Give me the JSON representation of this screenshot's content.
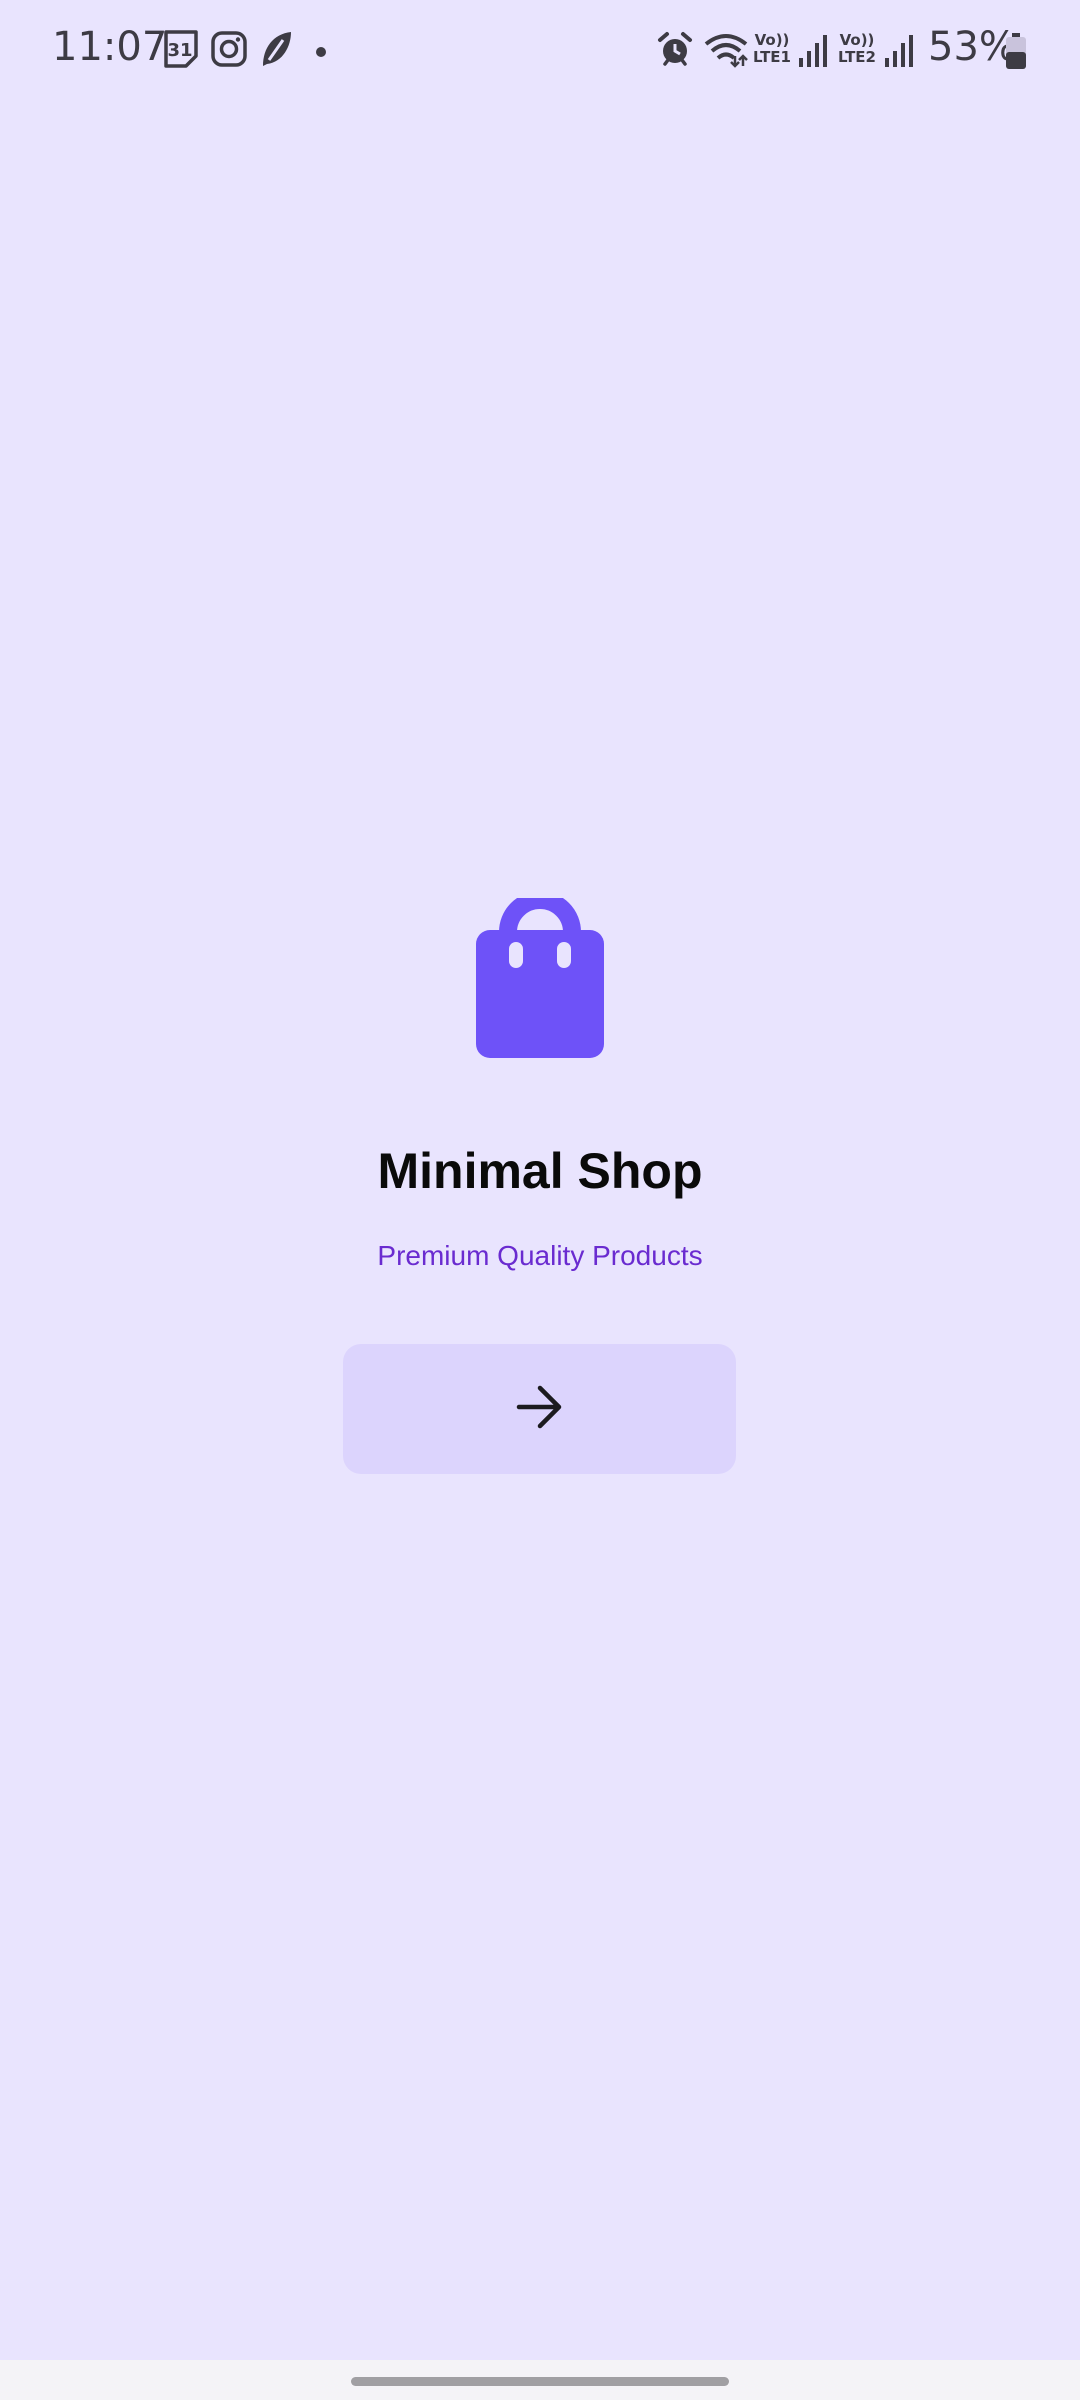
{
  "status_bar": {
    "time": "11:07",
    "calendar_day": "31",
    "sim1_label": "Vo))\nLTE1",
    "sim2_label": "Vo))\nLTE2",
    "battery_percent": "53%",
    "icons": [
      "calendar-icon",
      "instagram-icon",
      "feather-app-icon",
      "notification-dot-icon",
      "alarm-icon",
      "wifi-icon",
      "signal-icon",
      "battery-icon"
    ]
  },
  "splash": {
    "logo_icon": "shopping-bag-icon",
    "title": "Minimal Shop",
    "subtitle": "Premium Quality Products",
    "next_button_icon": "arrow-right-icon"
  },
  "colors": {
    "background": "#e9e4fe",
    "accent": "#6e52f8",
    "subtitle": "#6a2bd0",
    "button_bg": "#dcd4fd"
  }
}
